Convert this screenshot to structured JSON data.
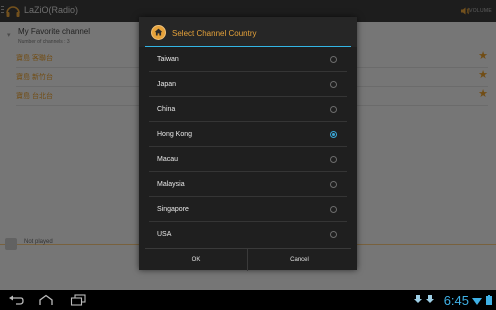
{
  "app": {
    "title": "LaZiO(Radio)",
    "volume_label": "VOLUME"
  },
  "favorites": {
    "title": "My Favorite channel",
    "count_text": "Number of channels : 3",
    "channels": [
      {
        "name": "寶島 客聯台"
      },
      {
        "name": "寶島 新竹台"
      },
      {
        "name": "寶島 台北台"
      }
    ]
  },
  "player": {
    "status": "Not played"
  },
  "dialog": {
    "title": "Select Channel Country",
    "options": [
      {
        "label": "Taiwan",
        "selected": false
      },
      {
        "label": "Japan",
        "selected": false
      },
      {
        "label": "China",
        "selected": false
      },
      {
        "label": "Hong Kong",
        "selected": true
      },
      {
        "label": "Macau",
        "selected": false
      },
      {
        "label": "Malaysia",
        "selected": false
      },
      {
        "label": "Singapore",
        "selected": false
      },
      {
        "label": "USA",
        "selected": false
      }
    ],
    "ok_label": "OK",
    "cancel_label": "Cancel"
  },
  "status_bar": {
    "time": "6:45"
  },
  "colors": {
    "accent": "#e39a2a",
    "holo_blue": "#33b5e5",
    "dialog_bg": "#1f1f1f"
  },
  "icons": {
    "app": "headphones-icon",
    "volume": "speaker-icon",
    "dialog": "home-icon",
    "favorite": "star-icon",
    "nav": [
      "back-icon",
      "home-icon",
      "recent-apps-icon"
    ]
  }
}
